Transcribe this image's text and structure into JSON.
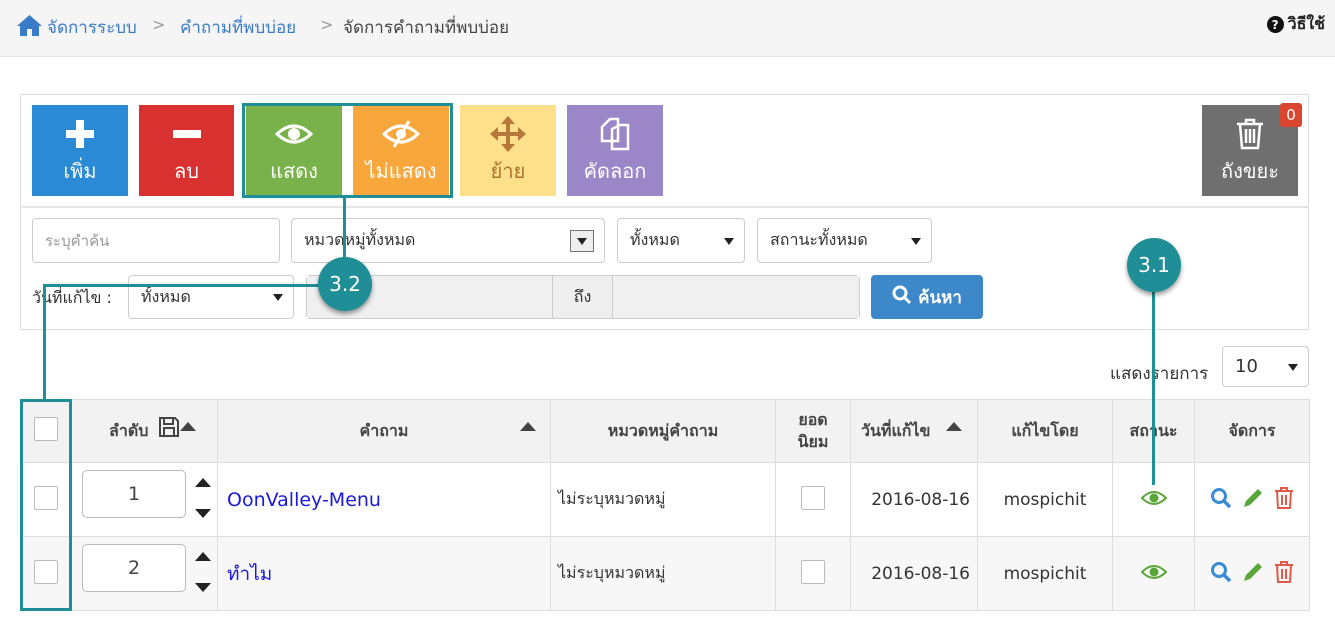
{
  "breadcrumb": {
    "home": "จัดการระบบ",
    "faq": "คำถามที่พบบ่อย",
    "current": "จัดการคำถามที่พบบ่อย",
    "separator": ">"
  },
  "help": {
    "label": "วิธีใช้",
    "icon": "question-circle-icon"
  },
  "toolbar": {
    "add": "เพิ่ม",
    "delete": "ลบ",
    "show": "แสดง",
    "hide": "ไม่แสดง",
    "move": "ย้าย",
    "copy": "คัดลอก",
    "trash": "ถังขยะ",
    "trash_count": "0"
  },
  "filters": {
    "search_placeholder": "ระบุคำค้น",
    "category": "หมวดหมู่ทั้งหมด",
    "all": "ทั้งหมด",
    "status": "สถานะทั้งหมด",
    "date_label": "วันที่แก้ไข :",
    "date_range": "ทั้งหมด",
    "to_label": "ถึง",
    "search_button": "ค้นหา"
  },
  "page_size": {
    "label": "แสดงรายการ",
    "value": "10"
  },
  "table": {
    "headers": {
      "order": "ลำดับ",
      "question": "คำถาม",
      "category": "หมวดหมู่คำถาม",
      "popular_1": "ยอด",
      "popular_2": "นิยม",
      "modified": "วันที่แก้ไข",
      "modified_by": "แก้ไขโดย",
      "status": "สถานะ",
      "manage": "จัดการ"
    },
    "rows": [
      {
        "order": "1",
        "question": "OonValley-Menu",
        "category": "ไม่ระบุหมวดหมู่",
        "modified": "2016-08-16",
        "modified_by": "mospichit"
      },
      {
        "order": "2",
        "question": "ทำไม",
        "category": "ไม่ระบุหมวดหมู่",
        "modified": "2016-08-16",
        "modified_by": "mospichit"
      }
    ]
  },
  "callouts": {
    "a": "3.1",
    "b": "3.2"
  },
  "colors": {
    "add": "#2b8ad6",
    "delete": "#d9312f",
    "show": "#79b24a",
    "hide": "#f7a73b",
    "move": "#ffe08a",
    "copy": "#9b87c8",
    "trash": "#6f6f6f",
    "callout": "#1f8e96",
    "link": "#1a1adf"
  }
}
